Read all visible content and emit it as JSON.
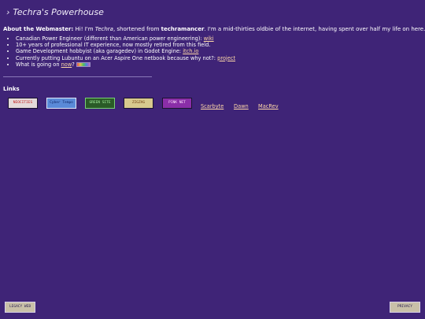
{
  "header": {
    "chevron": "›",
    "title": "Techra's Powerhouse"
  },
  "about": {
    "label": "About the Webmaster:",
    "text1": " Hi! I'm ",
    "name_italic": "Techra",
    "text2": ", shortened from ",
    "handle_bold": "techramancer",
    "text3": ". I'm a mid-thirties oldbie of the internet, having spent over half my life on here."
  },
  "bullets": [
    {
      "text": "Canadian Power Engineer (different than American power engineering): ",
      "link": "wiki"
    },
    {
      "text": "10+ years of professional IT experience, now mostly retired from this field.",
      "link": ""
    },
    {
      "text": "Game Development hobbyist (aka garagedev) in Godot Engine: ",
      "link": "itch.io"
    },
    {
      "text": "Currently putting Lubuntu on an Acer Aspire One netbook because why not?: ",
      "link": "project"
    },
    {
      "text": "What is going on ",
      "link": "now",
      "suffix": "?"
    }
  ],
  "links_title": "Links",
  "badges": [
    {
      "name": "badge-red",
      "text": "NEOCITIES"
    },
    {
      "name": "badge-blue",
      "text": "Cyber Tempo"
    },
    {
      "name": "badge-green",
      "text": "GREEN SITE"
    },
    {
      "name": "badge-cream",
      "text": "ZIGZAG"
    },
    {
      "name": "badge-purple",
      "text": "PINK NET"
    }
  ],
  "text_links": [
    "Scarbyte",
    "Dawn",
    "MacRev"
  ],
  "footer": {
    "left_badge": "LEGACY WEB",
    "right_badge": "PRIVACY"
  },
  "colors": {
    "background": "#3f2477",
    "link": "#ffd9a8"
  }
}
